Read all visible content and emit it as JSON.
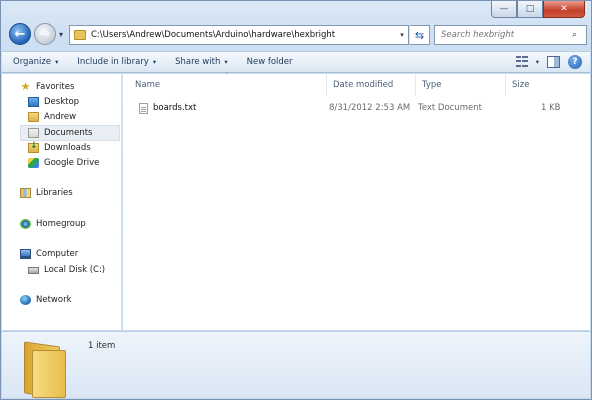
{
  "window": {
    "caption": {
      "minimize": "—",
      "maximize": "□",
      "close": "✕"
    }
  },
  "nav": {
    "back_glyph": "←",
    "forward_glyph": "→",
    "history_glyph": "▾",
    "address_path": "C:\\Users\\Andrew\\Documents\\Arduino\\hardware\\hexbright",
    "address_dropdown_glyph": "▾",
    "refresh_glyph": "⇆",
    "search_placeholder": "Search hexbright",
    "search_glyph": "⌕"
  },
  "toolbar": {
    "organize": "Organize",
    "include_in_library": "Include in library",
    "share_with": "Share with",
    "new_folder": "New folder",
    "dropdown_glyph": "▾",
    "help_glyph": "?"
  },
  "sidebar": {
    "favorites": {
      "label": "Favorites",
      "icon": "star-icon"
    },
    "favorite_items": [
      {
        "label": "Desktop",
        "icon": "desktop-icon"
      },
      {
        "label": "Andrew",
        "icon": "user-folder-icon"
      },
      {
        "label": "Documents",
        "icon": "documents-icon",
        "selected": true
      },
      {
        "label": "Downloads",
        "icon": "downloads-icon"
      },
      {
        "label": "Google Drive",
        "icon": "google-drive-icon"
      }
    ],
    "libraries": {
      "label": "Libraries",
      "icon": "libraries-icon"
    },
    "homegroup": {
      "label": "Homegroup",
      "icon": "homegroup-icon"
    },
    "computer": {
      "label": "Computer",
      "icon": "computer-icon"
    },
    "local_disk": {
      "label": "Local Disk (C:)",
      "icon": "disk-icon"
    },
    "network": {
      "label": "Network",
      "icon": "network-icon"
    }
  },
  "columns": {
    "name": "Name",
    "date_modified": "Date modified",
    "type": "Type",
    "size": "Size",
    "sort_glyph": "˄"
  },
  "files": [
    {
      "name": "boards.txt",
      "date_modified": "8/31/2012 2:53 AM",
      "type": "Text Document",
      "size": "1 KB",
      "icon": "text-file-icon"
    }
  ],
  "details": {
    "count": "1 item",
    "icon": "folder-icon"
  },
  "colors": {
    "window_frame": "#c4d8ee",
    "close_button": "#c4402a",
    "selection": "#e9eef5"
  }
}
